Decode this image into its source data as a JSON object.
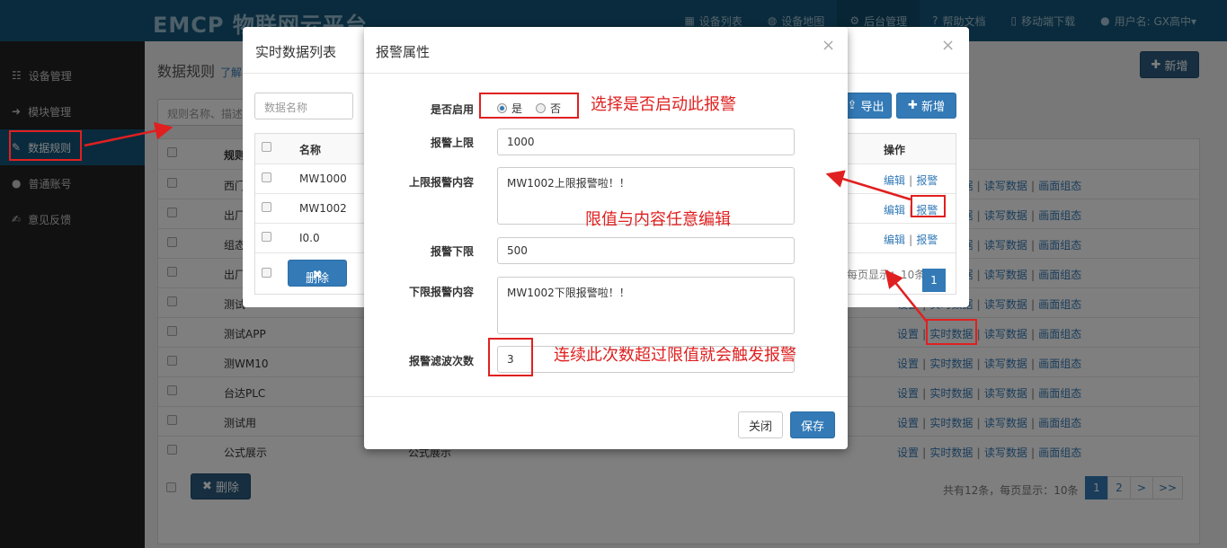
{
  "topbar": {
    "logo": "EMCP 物联网云平台",
    "nav": [
      "设备列表",
      "设备地图",
      "后台管理",
      "帮助文档",
      "移动端下载",
      "用户名: GX高中▾"
    ]
  },
  "sidebar": {
    "items": [
      "设备管理",
      "模块管理",
      "数据规则",
      "普通账号",
      "意见反馈"
    ]
  },
  "main": {
    "title": "数据规则",
    "title_link": "了解",
    "add_label": "新增",
    "search_placeholder": "规则名称、描述",
    "header_col": "规则",
    "rows": [
      "西门",
      "出厂",
      "组态",
      "出厂",
      "测试",
      "测试APP",
      "测WM10",
      "台达PLC",
      "测试用",
      "公式展示"
    ],
    "last_desc": "公式展示",
    "ops": {
      "settings": "设置",
      "realtime": "实时数据",
      "write": "读写数据",
      "screen": "画面组态"
    },
    "delete_label": "删除",
    "footer_info": "共有12条，每页显示：10条",
    "pages": [
      "1",
      "2",
      ">",
      ">>"
    ]
  },
  "modal_list": {
    "title": "实时数据列表",
    "search_placeholder": "数据名称",
    "export_label": "导出",
    "add_label": "新增",
    "col_name": "名称",
    "col_ops": "操作",
    "rows": [
      {
        "name": "MW1000"
      },
      {
        "name": "MW1002"
      },
      {
        "name": "I0.0"
      }
    ],
    "edit": "编辑",
    "alarm": "报警",
    "delete_label": "删除",
    "page_info": "每页显示：10条",
    "page": "1"
  },
  "modal_alarm": {
    "title": "报警属性",
    "enable_label": "是否启用",
    "yes": "是",
    "no": "否",
    "upper_label": "报警上限",
    "upper_value": "1000",
    "upper_content_label": "上限报警内容",
    "upper_content": "MW1002上限报警啦！！",
    "lower_label": "报警下限",
    "lower_value": "500",
    "lower_content_label": "下限报警内容",
    "lower_content": "MW1002下限报警啦！！",
    "filter_label": "报警滤波次数",
    "filter_value": "3",
    "close_label": "关闭",
    "save_label": "保存"
  },
  "annotations": {
    "note1": "选择是否启动此报警",
    "note2": "限值与内容任意编辑",
    "note3": "连续此次数超过限值就会触发报警"
  },
  "colors": {
    "annotation": "#e02020",
    "primary": "#337ab7",
    "topbar": "#14577a"
  }
}
